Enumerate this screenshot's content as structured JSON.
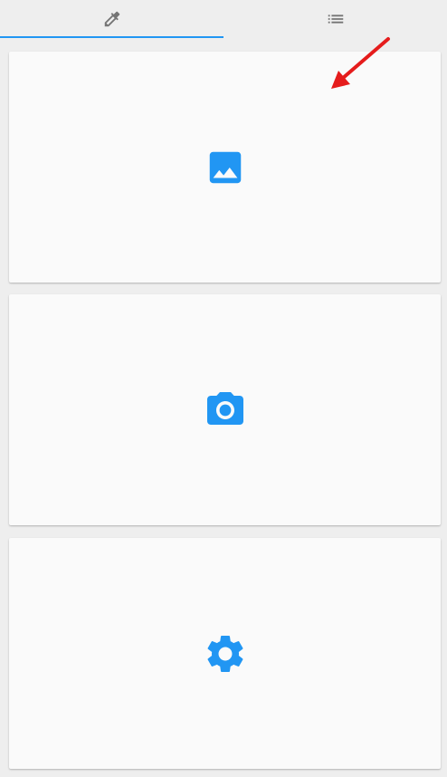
{
  "tabs": [
    {
      "id": "picker",
      "icon": "eyedropper-icon",
      "active": true
    },
    {
      "id": "list",
      "icon": "list-icon",
      "active": false
    }
  ],
  "cards": [
    {
      "id": "gallery",
      "icon": "image-icon"
    },
    {
      "id": "camera",
      "icon": "camera-icon"
    },
    {
      "id": "settings",
      "icon": "gear-icon"
    }
  ],
  "annotation": {
    "icon": "arrow-icon",
    "color": "#e51c1c"
  },
  "colors": {
    "accent": "#2196f3",
    "tab_icon": "#757575",
    "background": "#eeeeee",
    "card": "#fafafa"
  }
}
